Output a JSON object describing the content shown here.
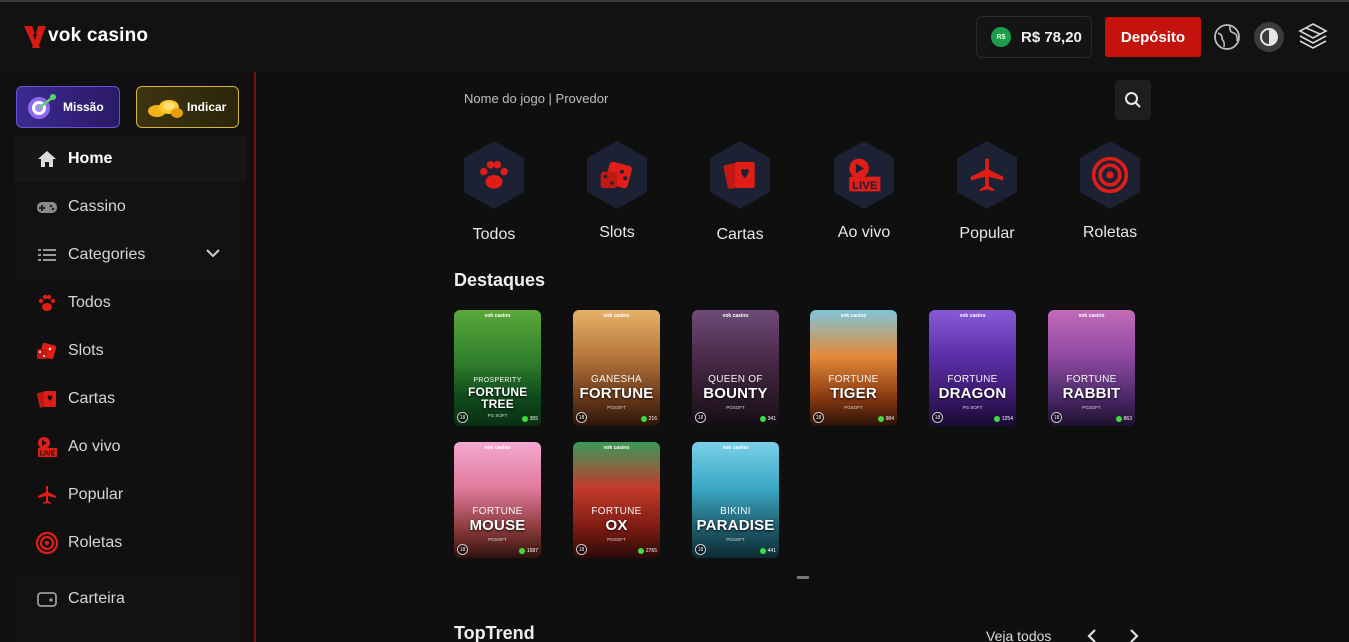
{
  "header": {
    "logo_text": "vok casino",
    "balance_currency_badge": "R$",
    "balance": "R$ 78,20",
    "deposit_label": "Depósito",
    "icons": [
      "globe-icon",
      "theme-toggle-icon",
      "brand-emblem-icon"
    ]
  },
  "sidebar": {
    "promos": [
      {
        "label": "Missão",
        "icon": "target-dart-icon"
      },
      {
        "label": "Indicar",
        "icon": "coins-icon"
      }
    ],
    "items": [
      {
        "label": "Home",
        "icon": "home-icon",
        "active": true
      },
      {
        "label": "Cassino",
        "icon": "gamepad-icon"
      },
      {
        "label": "Categories",
        "icon": "list-icon"
      },
      {
        "label": "Todos",
        "icon": "paw-icon"
      },
      {
        "label": "Slots",
        "icon": "dice-icon"
      },
      {
        "label": "Cartas",
        "icon": "cards-icon"
      },
      {
        "label": "Ao vivo",
        "icon": "live-icon"
      },
      {
        "label": "Popular",
        "icon": "airplane-icon"
      },
      {
        "label": "Roletas",
        "icon": "roulette-icon"
      },
      {
        "label": "Carteira",
        "icon": "wallet-icon"
      }
    ]
  },
  "search": {
    "placeholder": "Nome do jogo | Provedor"
  },
  "categories": [
    {
      "label": "Todos",
      "icon": "paw-icon"
    },
    {
      "label": "Slots",
      "icon": "dice-icon"
    },
    {
      "label": "Cartas",
      "icon": "cards-icon"
    },
    {
      "label": "Ao vivo",
      "icon": "live-icon"
    },
    {
      "label": "Popular",
      "icon": "airplane-icon"
    },
    {
      "label": "Roletas",
      "icon": "roulette-icon"
    }
  ],
  "featured": {
    "title": "Destaques",
    "games": [
      {
        "line1": "PROSPERITY",
        "line2": "FORTUNE TREE",
        "provider": "PG SOFT",
        "age": "18",
        "count": "355"
      },
      {
        "line1": "GANESHA",
        "line2": "FORTUNE",
        "provider": "PGSOFT",
        "age": "18",
        "count": "216"
      },
      {
        "line1": "QUEEN OF",
        "line2": "BOUNTY",
        "provider": "PGSOFT",
        "age": "18",
        "count": "341"
      },
      {
        "line1": "FORTUNE",
        "line2": "TIGER",
        "provider": "PGSOFT",
        "age": "18",
        "count": "984"
      },
      {
        "line1": "FORTUNE",
        "line2": "DRAGON",
        "provider": "PG SOFT",
        "age": "18",
        "count": "1254"
      },
      {
        "line1": "FORTUNE",
        "line2": "RABBIT",
        "provider": "PGSOFT",
        "age": "18",
        "count": "863"
      },
      {
        "line1": "FORTUNE",
        "line2": "MOUSE",
        "provider": "PGSOFT",
        "age": "18",
        "count": "1587"
      },
      {
        "line1": "FORTUNE",
        "line2": "OX",
        "provider": "PGSOFT",
        "age": "18",
        "count": "2765"
      },
      {
        "line1": "BIKINI",
        "line2": "PARADISE",
        "provider": "PGSOFT",
        "age": "18",
        "count": "441"
      }
    ],
    "brand": "vok casino"
  },
  "toptrend": {
    "title": "TopTrend",
    "see_all": "Veja todos"
  },
  "colors": {
    "accent": "#c4120c",
    "background": "#0f0f0f",
    "hex_bg": "#1c2233"
  }
}
